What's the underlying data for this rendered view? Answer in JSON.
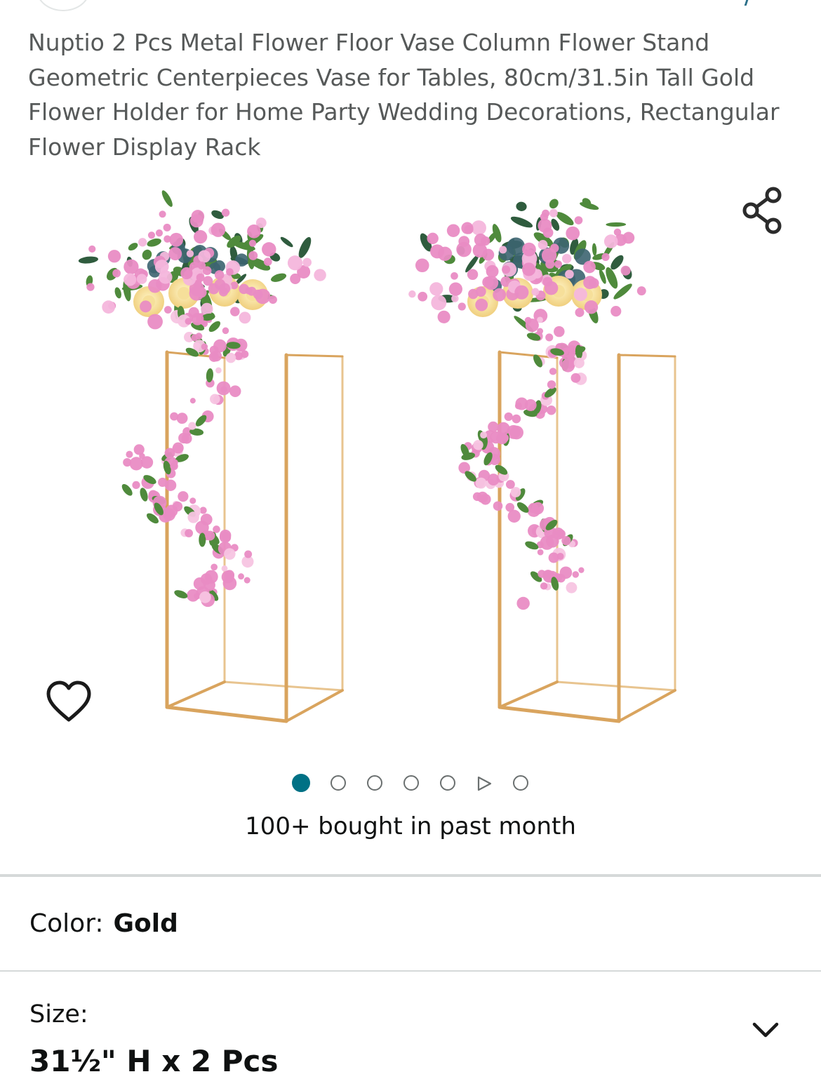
{
  "product": {
    "title": "Nuptio 2 Pcs Metal Flower Floor Vase Column Flower Stand Geometric Centerpieces Vase for Tables, 80cm/31.5in Tall Gold Flower Holder for Home Party Wedding Decorations, Rectangular Flower Display Rack"
  },
  "gallery": {
    "image_count": 7,
    "active_index": 1,
    "video_index": 6,
    "share_icon": "share-icon",
    "wishlist_icon": "heart-icon"
  },
  "social_proof": {
    "bought_text": "100+ bought in past month"
  },
  "color": {
    "label": "Color:",
    "value": "Gold"
  },
  "size": {
    "label": "Size:",
    "value": "31½\" H x 2 Pcs",
    "dropdown_icon": "chevron-down-icon"
  },
  "colors": {
    "accent": "#007185",
    "gold_frame": "#d9a45e",
    "flower_pink": "#e98cc4",
    "leaf_green": "#4f8a3c",
    "text_secondary": "#565959"
  }
}
